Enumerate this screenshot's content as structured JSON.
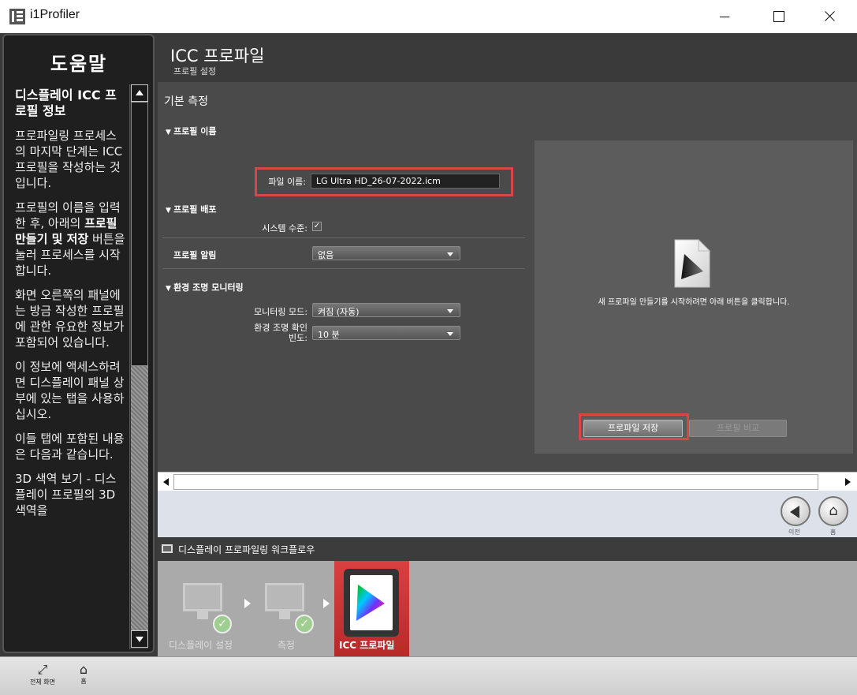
{
  "window": {
    "title": "i1Profiler"
  },
  "help": {
    "title": "도움말",
    "heading": "디스플레이 ICC 프로필 정보",
    "p1": "프로파일링 프로세스의 마지막 단계는 ICC 프로필을 작성하는 것입니다.",
    "p2_a": "프로필의 이름을 입력한 후, 아래의 ",
    "p2_b": "프로필 만들기 및 저장",
    "p2_c": " 버튼을 눌러 프로세스를 시작합니다.",
    "p3": "화면 오른쪽의 패널에는 방금 작성한 프로필에 관한 유요한 정보가 포함되어 있습니다.",
    "p4": "이 정보에 액세스하려면 디스플레이 패널 상부에 있는 탭을 사용하십시오.",
    "p5": "이들 탭에 포함된 내용은 다음과 같습니다.",
    "p6": "3D 색역 보기 - 디스플레이 프로필의 3D 색역을"
  },
  "header": {
    "title": "ICC 프로파일",
    "subtitle": "프로필 설정"
  },
  "settings": {
    "section_title": "기본 측정",
    "profile_name_group": "프로필 이름",
    "file_name_label": "파일 이름:",
    "file_name_value": "LG Ultra HD_26-07-2022.icm",
    "profile_deploy_group": "프로필 배포",
    "system_level_label": "시스템 수준:",
    "system_level_checked": "✓",
    "profile_reminder_label": "프로필 알림",
    "profile_reminder_value": "없음",
    "ambient_group": "환경 조명 모니터링",
    "monitor_mode_label": "모니터링 모드:",
    "monitor_mode_value": "켜짐 (자동)",
    "ambient_freq_label_1": "환경 조명 확인",
    "ambient_freq_label_2": "빈도:",
    "ambient_freq_value": "10 분"
  },
  "preview": {
    "message": "새 프로파일 만들기를 시작하려면 아래 버튼을 클릭합니다.",
    "save_button": "프로파일 저장",
    "compare_button": "프로필 비교"
  },
  "nav": {
    "prev_label": "이전",
    "home_label": "홈"
  },
  "workflow": {
    "title": "디스플레이 프로파일링 워크플로우",
    "steps": [
      {
        "label": "디스플레이 설정"
      },
      {
        "label": "측정"
      },
      {
        "label": "ICC 프로파일"
      }
    ]
  },
  "bottom": {
    "fullscreen_label": "전체 화면",
    "home_label": "홈"
  },
  "colors": {
    "accent": "#d84646",
    "active_step": "#c93434"
  }
}
